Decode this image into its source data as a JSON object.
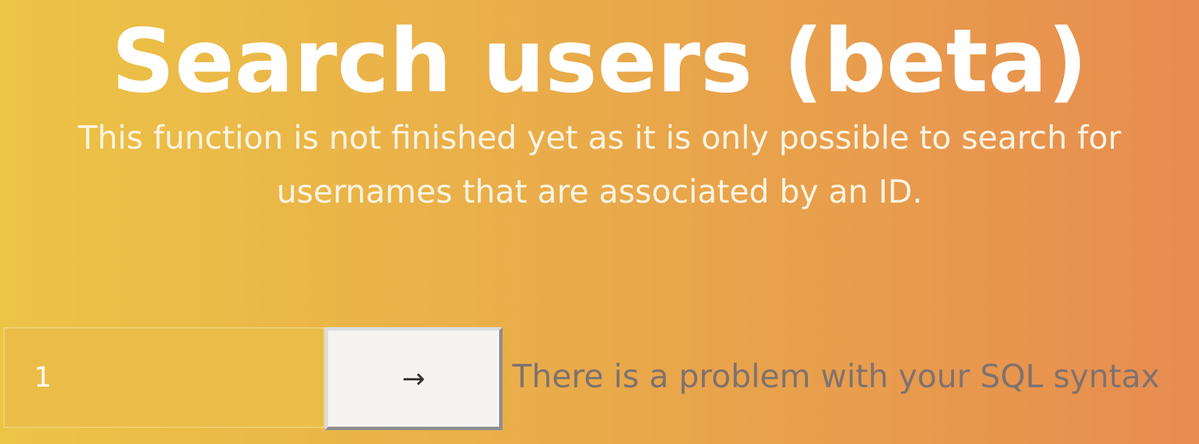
{
  "page": {
    "title": "Search users (beta)",
    "description": "This function is not finished yet as it is only possible to search for usernames that are associated by an ID."
  },
  "search": {
    "value": "1",
    "submit_label": "→"
  },
  "status": {
    "error_message": "There is a problem with your SQL syntax"
  },
  "colors": {
    "gradient_start": "#ecc446",
    "gradient_end": "#e88c50",
    "title_text": "#ffffff",
    "error_text": "#7e7270",
    "button_bg": "#f5f4f1"
  }
}
